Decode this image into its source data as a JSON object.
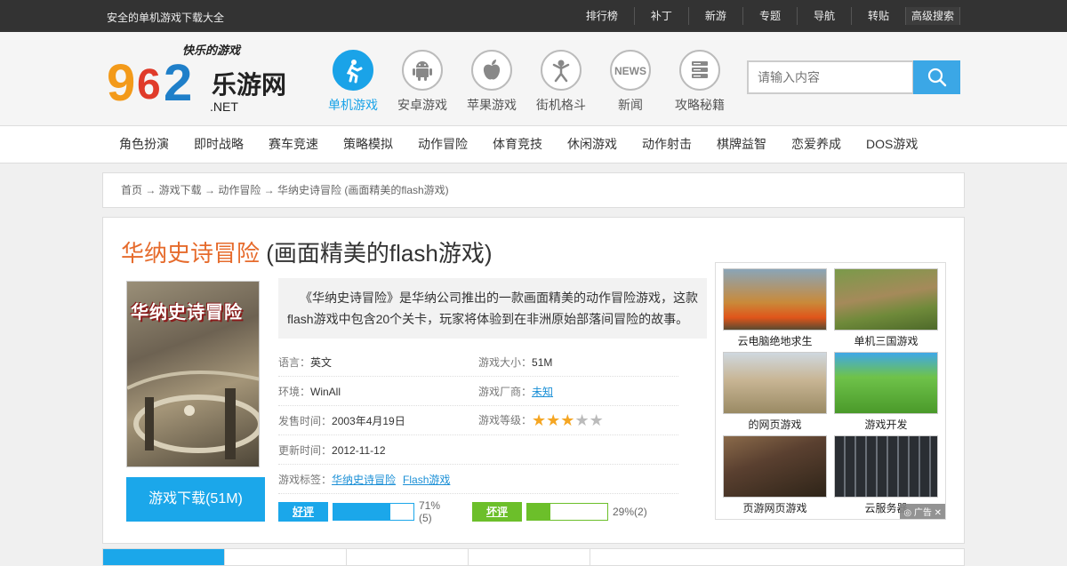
{
  "topbar": {
    "tagline": "安全的单机游戏下载大全",
    "links": [
      "排行榜",
      "补丁",
      "新游",
      "专题",
      "导航",
      "转贴",
      "高级搜索"
    ]
  },
  "logo": {
    "tagline": "快乐的游戏",
    "number": "9 2",
    "name": "乐游网",
    "suffix": ".NET"
  },
  "categories": [
    {
      "label": "单机游戏",
      "icon": "crosshair-runner-icon",
      "active": true
    },
    {
      "label": "安卓游戏",
      "icon": "android-icon"
    },
    {
      "label": "苹果游戏",
      "icon": "apple-icon"
    },
    {
      "label": "街机格斗",
      "icon": "fighter-icon"
    },
    {
      "label": "新闻",
      "icon": "news-icon"
    },
    {
      "label": "攻略秘籍",
      "icon": "book-stack-icon"
    }
  ],
  "search": {
    "placeholder": "请输入内容",
    "icon": "search-icon"
  },
  "genres": [
    "角色扮演",
    "即时战略",
    "赛车竞速",
    "策略模拟",
    "动作冒险",
    "体育竞技",
    "休闲游戏",
    "动作射击",
    "棋牌益智",
    "恋爱养成",
    "DOS游戏"
  ],
  "breadcrumb": "首页 → 游戏下载 → 动作冒险 → 华纳史诗冒险 (画面精美的flash游戏)",
  "game": {
    "title": "华纳史诗冒险",
    "subtitle": " (画面精美的flash游戏)",
    "cover_text": "华纳史诗冒险",
    "download_label": "游戏下载(51M)",
    "description": "《华纳史诗冒险》是华纳公司推出的一款画面精美的动作冒险游戏，这款flash游戏中包含20个关卡，玩家将体验到在非洲原始部落间冒险的故事。",
    "language_label": "语言：",
    "language": "英文",
    "size_label": "游戏大小：",
    "size": "51M",
    "env_label": "环境：",
    "env": "WinAll",
    "vendor_label": "游戏厂商：",
    "vendor": "未知",
    "release_label": "发售时间：",
    "release": "2003年4月19日",
    "rating_label": "游戏等级：",
    "rating": 3,
    "rating_max": 5,
    "updated_label": "更新时间：",
    "updated": "2012-11-12",
    "tags_label": "游戏标签：",
    "tags": [
      "华纳史诗冒险",
      "Flash游戏"
    ]
  },
  "votes": {
    "good_label": "好评",
    "good_pct": 71,
    "good_text": "71%(5)",
    "bad_label": "坏评",
    "bad_pct": 29,
    "bad_text": "29%(2)",
    "good_color": "#1ba7ea",
    "bad_color": "#6cbf2a"
  },
  "ads": {
    "items": [
      "云电脑绝地求生",
      "单机三国游戏",
      "的网页游戏",
      "游戏开发",
      "页游网页游戏",
      "云服务器"
    ],
    "tag": "广告"
  }
}
